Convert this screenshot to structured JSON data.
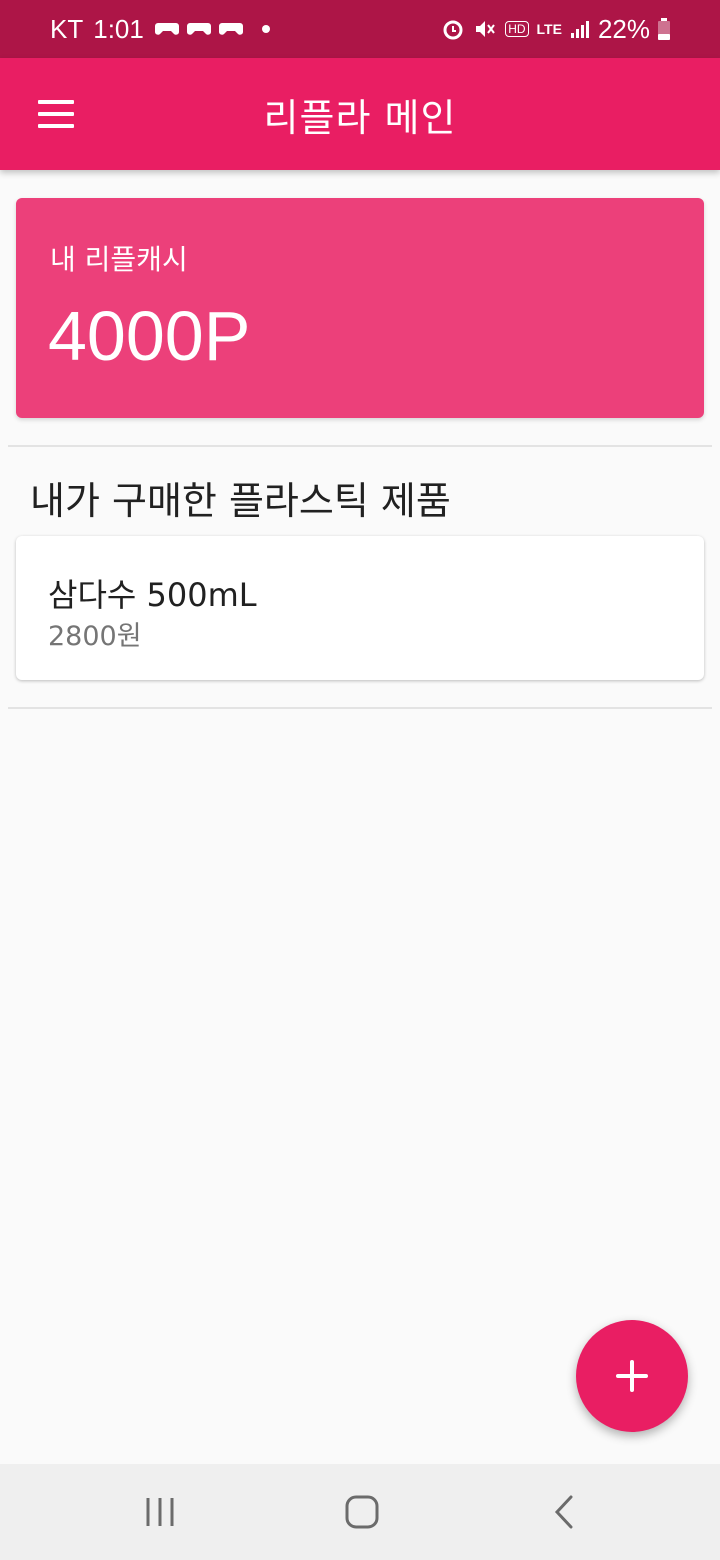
{
  "status_bar": {
    "carrier": "KT",
    "time": "1:01",
    "lte": "LTE",
    "hd": "HD",
    "battery": "22%"
  },
  "app_bar": {
    "title": "리플라 메인"
  },
  "cash_card": {
    "label": "내 리플캐시",
    "amount": "4000P"
  },
  "section": {
    "title": "내가 구매한 플라스틱 제품"
  },
  "products": [
    {
      "name": "삼다수 500mL",
      "price": "2800원"
    }
  ],
  "colors": {
    "primary": "#e91e63",
    "primary_dark": "#ad1547",
    "card": "#ec407a"
  },
  "icons": {
    "menu": "hamburger-menu-icon",
    "fab": "add-icon",
    "nav_recent": "recent-apps-icon",
    "nav_home": "home-icon",
    "nav_back": "back-icon"
  }
}
